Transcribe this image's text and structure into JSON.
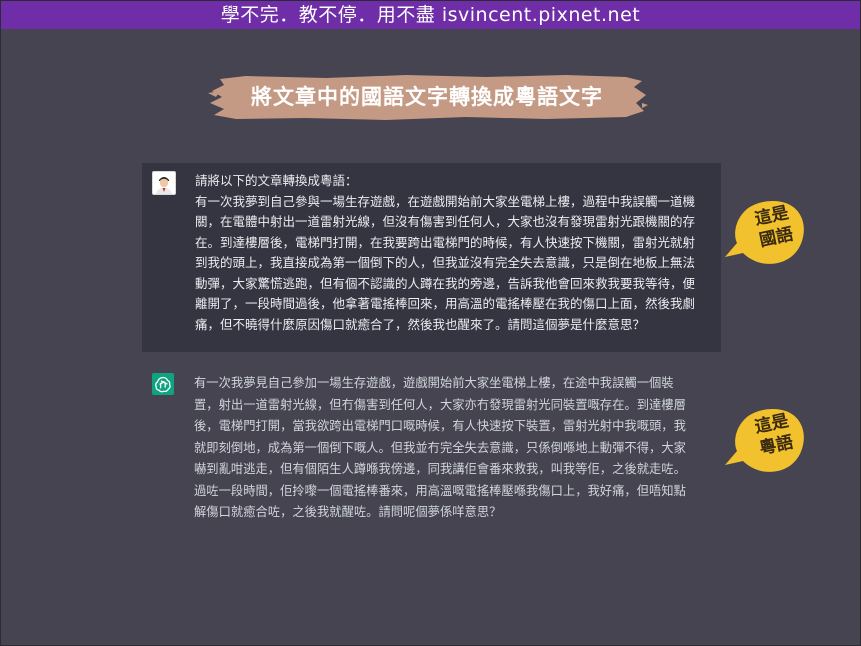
{
  "banner": {
    "text": "學不完．教不停．用不盡 isvincent.pixnet.net"
  },
  "title": {
    "text": "將文章中的國語文字轉換成粵語文字",
    "brush_color": "#c49a85"
  },
  "user_message": {
    "lines": [
      "請將以下的文章轉換成粵語：",
      "有一次我夢到自己參與一場生存遊戲，在遊戲開始前大家坐電梯上樓，過程中我誤觸一道機",
      "關，在電體中射出一道雷射光線，但沒有傷害到任何人，大家也沒有發現雷射光跟機關的存",
      "在。到達樓層後，電梯門打開，在我要跨出電梯門的時候，有人快速按下機關，雷射光就射",
      "到我的頭上，我直接成為第一個倒下的人，但我並沒有完全失去意識，只是倒在地板上無法",
      "動彈，大家驚慌逃跑，但有個不認識的人蹲在我的旁邊，告訴我他會回來救我要我等待，便",
      "離開了，一段時間過後，他拿著電搖棒回來，用高溫的電搖棒壓在我的傷口上面，然後我劇",
      "痛，但不曉得什麼原因傷口就癒合了，然後我也醒來了。請問這個夢是什麼意思？"
    ]
  },
  "bot_message": {
    "lines": [
      "有一次我夢見自己參加一場生存遊戲，遊戲開始前大家坐電梯上樓，在途中我誤觸一個裝",
      "置，射出一道雷射光線，但冇傷害到任何人，大家亦冇發現雷射光同裝置嘅存在。到達樓層",
      "後，電梯門打開，當我欲跨出電梯門口嘅時候，有人快速按下裝置，雷射光射中我嘅頭，我",
      "就即刻倒地，成為第一個倒下嘅人。但我並冇完全失去意識，只係倒喺地上動彈不得，大家",
      "嚇到亂咁逃走，但有個陌生人蹲喺我傍邊，同我講佢會番來救我，叫我等佢，之後就走咗。",
      "過咗一段時間，佢拎嚟一個電搖棒番來，用高溫嘅電搖棒壓喺我傷口上，我好痛，但唔知點",
      "解傷口就癒合咗，之後我就醒咗。請問呢個夢係咩意思？"
    ]
  },
  "callouts": {
    "first": {
      "line1": "這是",
      "line2": "國語"
    },
    "second": {
      "line1": "這是",
      "line2": "粵語"
    },
    "color": "#f2c12e"
  },
  "icons": {
    "avatar": "user-avatar",
    "bot": "chatgpt-logo-icon"
  },
  "colors": {
    "background": "#454450",
    "banner": "#6f2da8",
    "user_box": "#343541",
    "bot_icon": "#10a37f"
  }
}
